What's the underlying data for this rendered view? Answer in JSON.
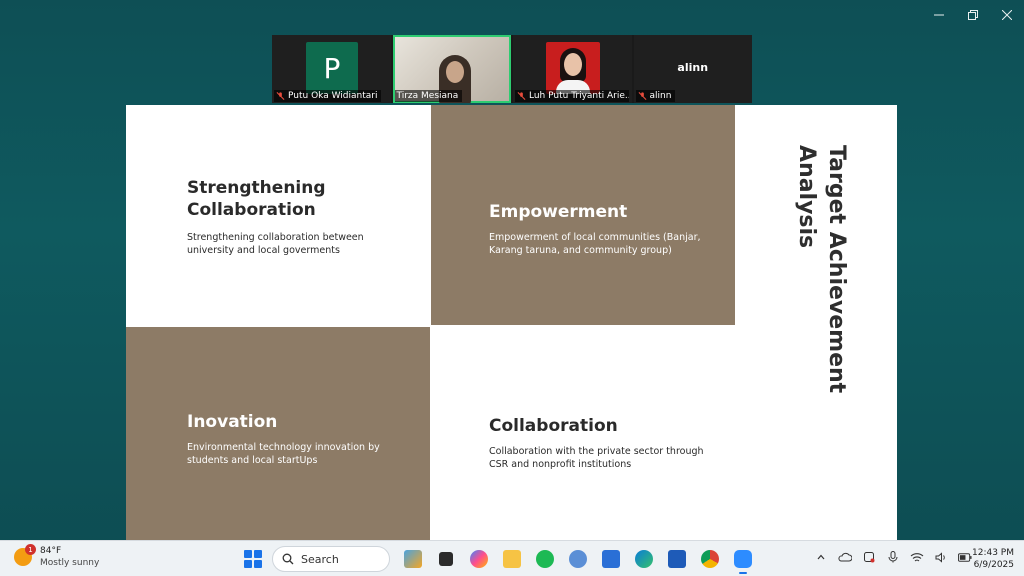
{
  "participants": [
    {
      "initial": "P",
      "name": "Putu Oka Widiantari"
    },
    {
      "initial": "",
      "name": "Tirza Mesiana"
    },
    {
      "initial": "",
      "name": "Luh Putu Triyanti Arie..."
    },
    {
      "display_name": "alinn",
      "name": "alinn"
    }
  ],
  "slide": {
    "vertical_title": "Target Achievement Analysis",
    "quadrants": [
      {
        "title": "Strengthening Collaboration",
        "text": "Strengthening collaboration between university and local goverments"
      },
      {
        "title": "Empowerment",
        "text": "Empowerment of local communities (Banjar, Karang taruna, and community group)"
      },
      {
        "title": "Inovation",
        "text": "Environmental technology innovation by students and local startUps"
      },
      {
        "title": "Collaboration",
        "text": "Collaboration with the private sector through CSR and nonprofit institutions"
      }
    ],
    "colors": {
      "brown": "#8d7b66",
      "white": "#ffffff"
    }
  },
  "taskbar": {
    "weather_temp": "84°F",
    "weather_desc": "Mostly sunny",
    "weather_badge": "1",
    "search_label": "Search",
    "time": "12:43 PM",
    "date": "6/9/2025"
  },
  "icons": [
    "minimize-icon",
    "restore-icon",
    "close-icon",
    "mic-off-icon",
    "search-icon",
    "windows-start-icon"
  ]
}
